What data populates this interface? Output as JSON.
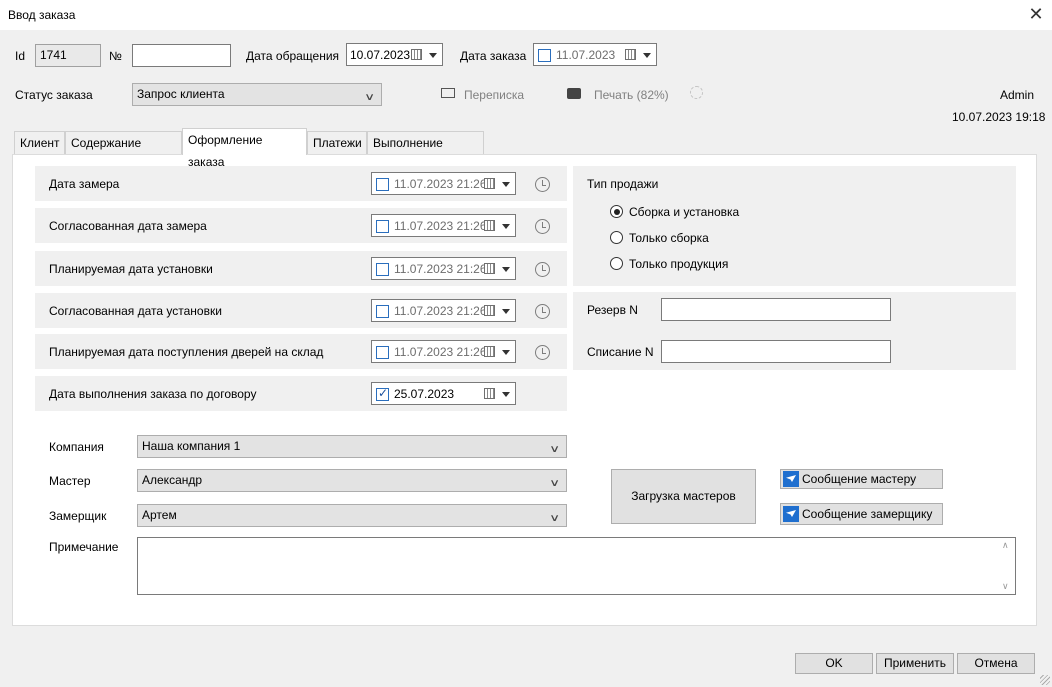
{
  "window": {
    "title": "Ввод заказа"
  },
  "header": {
    "id_label": "Id",
    "id_value": "1741",
    "num_label": "№",
    "num_value": "",
    "appeal_date_label": "Дата обращения",
    "appeal_date_value": "10.07.2023",
    "order_date_label": "Дата заказа",
    "order_date_value": "11.07.2023",
    "status_label": "Статус заказа",
    "status_value": "Запрос клиента",
    "correspondence_label": "Переписка",
    "print_label": "Печать (82%)",
    "user": "Admin",
    "datetime": "10.07.2023 19:18"
  },
  "tabs": [
    {
      "label": "Клиент"
    },
    {
      "label": "Содержание заказа"
    },
    {
      "label": "Оформление заказа"
    },
    {
      "label": "Платежи"
    },
    {
      "label": "Выполнение заказа"
    }
  ],
  "dates": [
    {
      "label": "Дата замера",
      "value": "11.07.2023 21:26",
      "checked": false
    },
    {
      "label": "Согласованная дата замера",
      "value": "11.07.2023 21:26",
      "checked": false
    },
    {
      "label": "Планируемая дата установки",
      "value": "11.07.2023 21:26",
      "checked": false
    },
    {
      "label": "Согласованная дата установки",
      "value": "11.07.2023 21:26",
      "checked": false
    },
    {
      "label": "Планируемая дата поступления дверей на склад",
      "value": "11.07.2023 21:26",
      "checked": false
    },
    {
      "label": "Дата выполнения заказа по договору",
      "value": "25.07.2023",
      "checked": true
    }
  ],
  "sale_type": {
    "title": "Тип продажи",
    "options": [
      {
        "label": "Сборка и установка",
        "selected": true
      },
      {
        "label": "Только сборка",
        "selected": false
      },
      {
        "label": "Только продукция",
        "selected": false
      }
    ]
  },
  "reserve": {
    "label": "Резерв N",
    "value": ""
  },
  "writeoff": {
    "label": "Списание N",
    "value": ""
  },
  "company": {
    "label": "Компания",
    "value": "Наша компания 1"
  },
  "master": {
    "label": "Мастер",
    "value": "Александр"
  },
  "measurer": {
    "label": "Замерщик",
    "value": "Артем"
  },
  "note": {
    "label": "Примечание",
    "value": ""
  },
  "buttons": {
    "load_masters": "Загрузка мастеров",
    "msg_master": "Сообщение мастеру",
    "msg_measurer": "Сообщение замерщику",
    "ok": "OK",
    "apply": "Применить",
    "cancel": "Отмена"
  }
}
